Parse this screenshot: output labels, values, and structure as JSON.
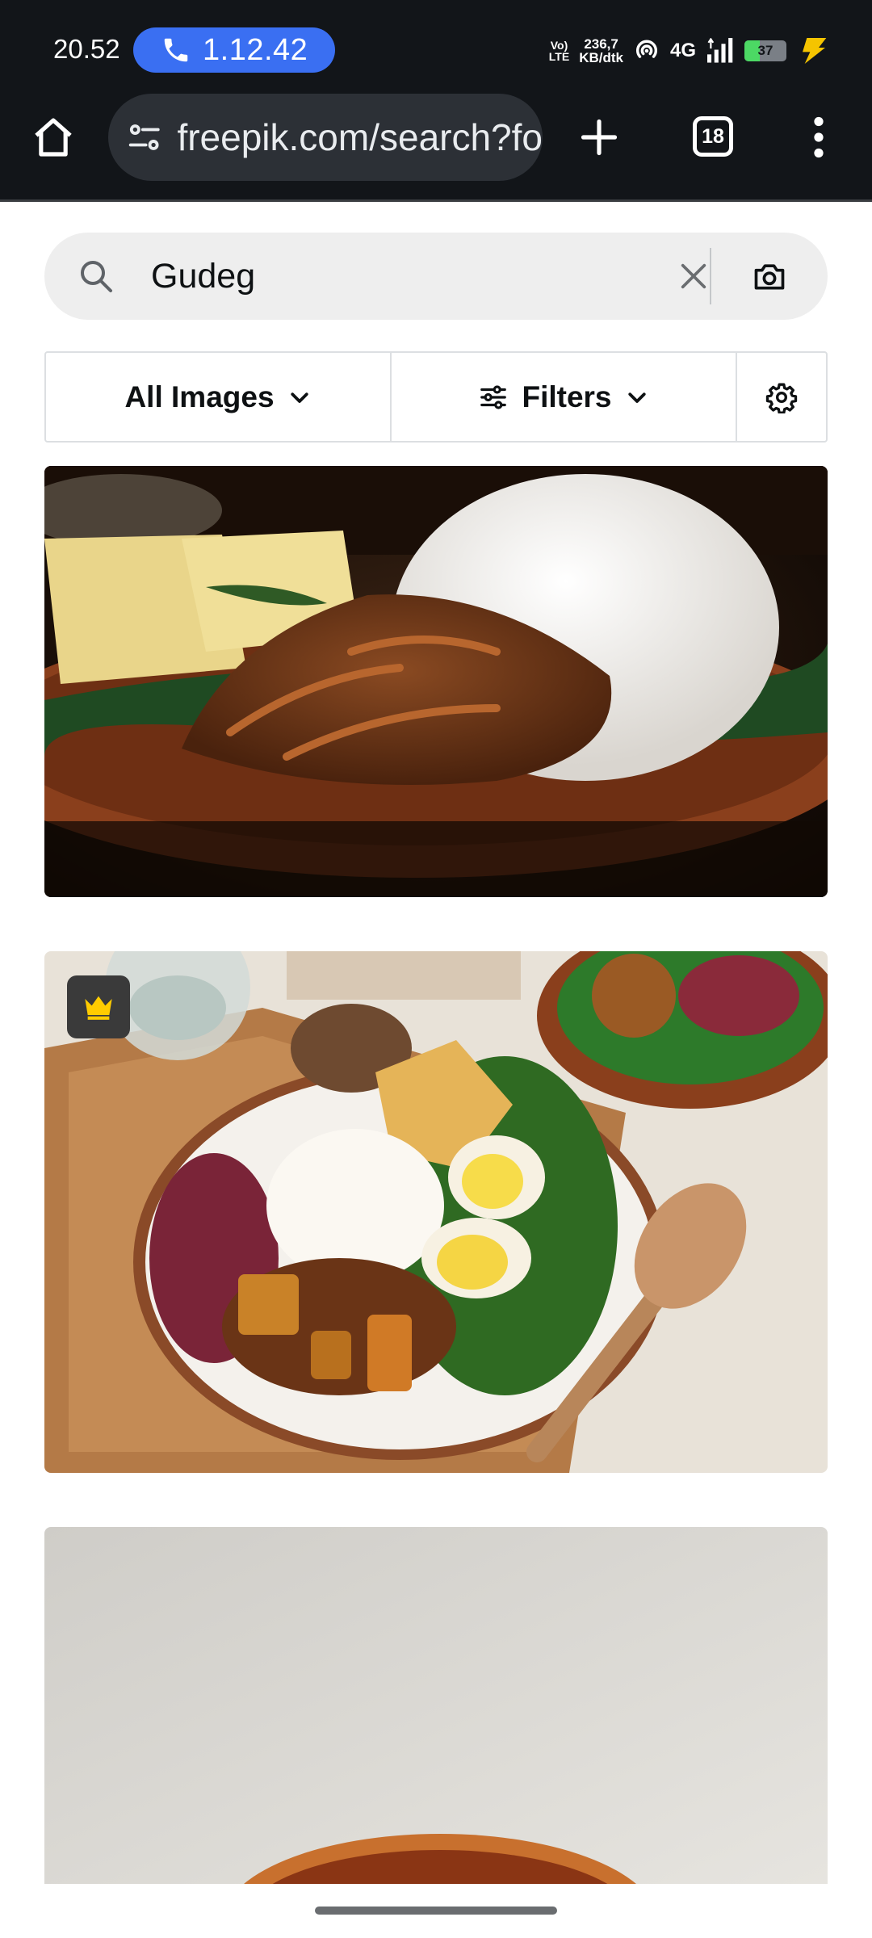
{
  "status_bar": {
    "time": "20.52",
    "call_timer": "1.12.42",
    "volte_line1": "Vo)",
    "volte_line2": "LTE",
    "net_speed_value": "236,7",
    "net_speed_unit": "KB/dtk",
    "network_type": "4G",
    "battery_level": "37",
    "battery_fraction": 0.37,
    "icons": [
      "phone-icon",
      "hotspot-icon",
      "signal-icon",
      "battery-icon",
      "charging-bolt-icon"
    ]
  },
  "browser": {
    "url": "freepik.com/search?fo",
    "tab_count": "18",
    "icons": [
      "home-icon",
      "site-info-icon",
      "new-tab-plus-icon",
      "tab-switcher-icon",
      "overflow-menu-icon"
    ]
  },
  "search": {
    "query": "Gudeg",
    "icons": [
      "search-icon",
      "clear-icon",
      "camera-icon"
    ]
  },
  "filters": {
    "all_images_label": "All Images",
    "filters_label": "Filters",
    "icons": [
      "chevron-down-icon",
      "sliders-icon",
      "settings-gear-icon"
    ]
  },
  "results": [
    {
      "premium": false
    },
    {
      "premium": true,
      "badge_icon": "crown-icon"
    },
    {
      "premium": false
    }
  ],
  "colors": {
    "status_bar_bg": "#121519",
    "call_pill": "#3a6ff2",
    "url_bar_bg": "#2c3036",
    "search_bg": "#eeeeee",
    "premium_crown": "#ffcc00",
    "battery_fill": "#4cd964",
    "charging_bolt": "#f5c400"
  }
}
